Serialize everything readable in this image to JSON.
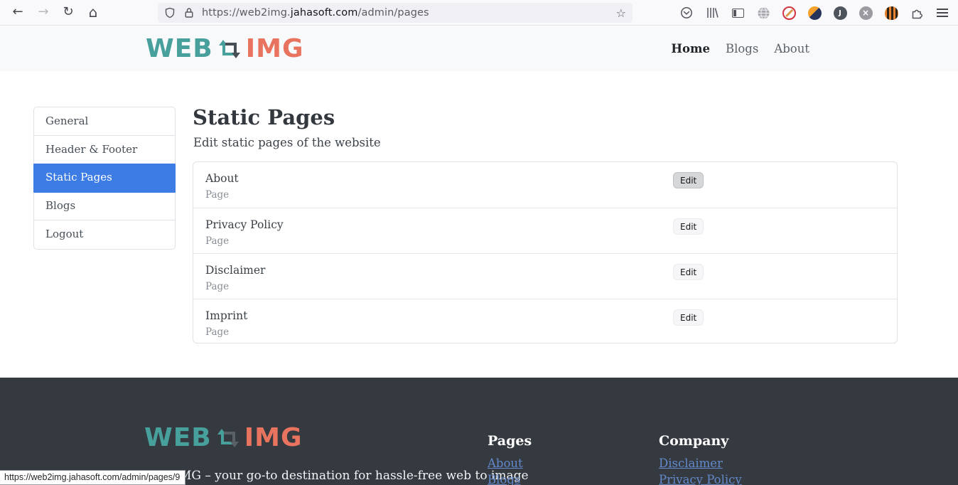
{
  "colors": {
    "brand_teal": "#48a09d",
    "brand_coral": "#e8745f",
    "active_sidebar_bg": "#3d7ce4",
    "footer_bg": "#343a40",
    "footer_link": "#6389cb",
    "edit_hover_bg": "#d6d7d9"
  },
  "browser": {
    "back_glyph": "←",
    "forward_glyph": "→",
    "reload_glyph": "↻",
    "home_glyph": "⌂",
    "star_glyph": "☆",
    "url_prefix": "https://web2img.",
    "url_domain": "jahasoft.com",
    "url_path": "/admin/pages",
    "extension_j_label": "J",
    "extension_x_glyph": "×",
    "status_tooltip": "https://web2img.jahasoft.com/admin/pages/9"
  },
  "header": {
    "logo_web": "WEB",
    "logo_img": "IMG",
    "nav": [
      {
        "label": "Home"
      },
      {
        "label": "Blogs"
      },
      {
        "label": "About"
      }
    ]
  },
  "sidebar": {
    "items": [
      {
        "label": "General"
      },
      {
        "label": "Header & Footer"
      },
      {
        "label": "Static Pages"
      },
      {
        "label": "Blogs"
      },
      {
        "label": "Logout"
      }
    ]
  },
  "main": {
    "title": "Static Pages",
    "subtitle": "Edit static pages of the website",
    "edit_label": "Edit",
    "rows": [
      {
        "title": "About",
        "type": "Page"
      },
      {
        "title": "Privacy Policy",
        "type": "Page"
      },
      {
        "title": "Disclaimer",
        "type": "Page"
      },
      {
        "title": "Imprint",
        "type": "Page"
      }
    ]
  },
  "footer": {
    "logo_web": "WEB",
    "logo_img": "IMG",
    "tagline_visible": "MG – your go-to destination for hassle-free web to image",
    "columns": [
      {
        "heading": "Pages",
        "links": [
          "About",
          "Blogs"
        ]
      },
      {
        "heading": "Company",
        "links": [
          "Disclaimer",
          "Privacy Policy"
        ]
      }
    ]
  }
}
